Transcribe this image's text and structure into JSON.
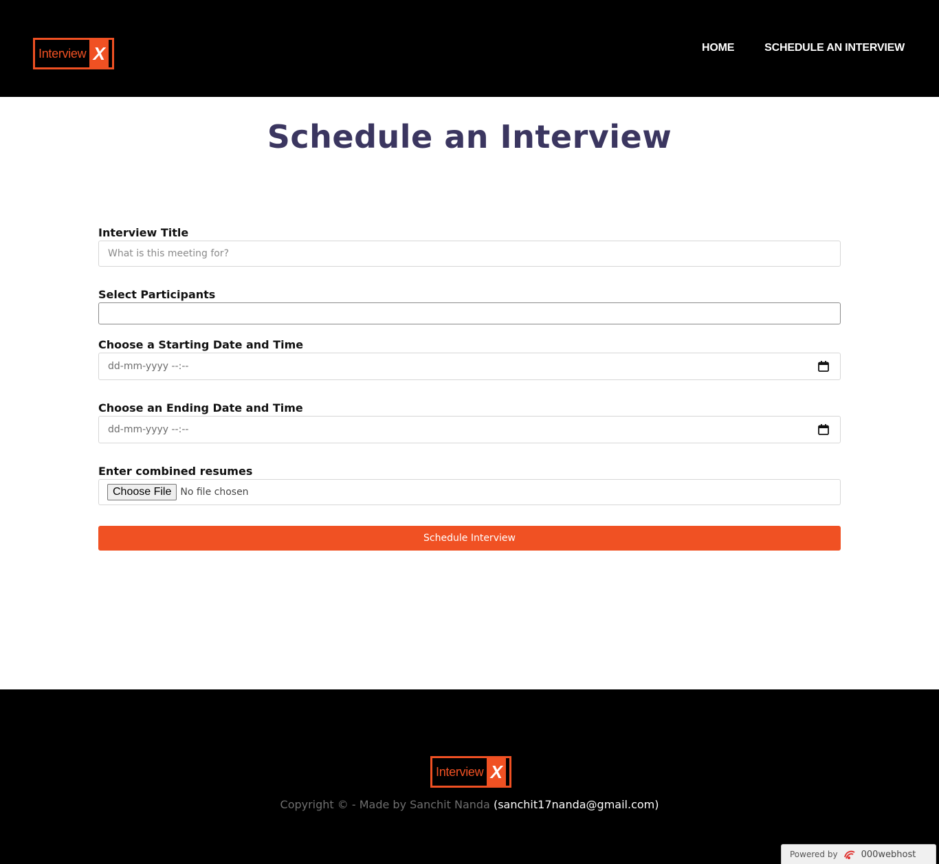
{
  "header": {
    "logo": {
      "text": "Interview",
      "mark": "X"
    },
    "nav": [
      {
        "label": "HOME"
      },
      {
        "label": "SCHEDULE AN INTERVIEW"
      }
    ]
  },
  "main": {
    "title": "Schedule an Interview",
    "form": {
      "interview_title": {
        "label": "Interview Title",
        "placeholder": "What is this meeting for?",
        "value": ""
      },
      "participants": {
        "label": "Select Participants",
        "value": ""
      },
      "start": {
        "label": "Choose a Starting Date and Time",
        "display": "dd-mm-yyyy --:--",
        "icon": "calendar-icon"
      },
      "end": {
        "label": "Choose an Ending Date and Time",
        "display": "dd-mm-yyyy --:--",
        "icon": "calendar-icon"
      },
      "resumes": {
        "label": "Enter combined resumes",
        "button": "Choose File",
        "status": "No file chosen"
      },
      "submit": {
        "label": "Schedule Interview"
      }
    }
  },
  "footer": {
    "logo": {
      "text": "Interview",
      "mark": "X"
    },
    "copyright": "Copyright © - Made by Sanchit Nanda",
    "email": "(sanchit17nanda@gmail.com)",
    "powered": {
      "label": "Powered by",
      "brand": "000webhost",
      "icon": "000webhost-logo-icon"
    }
  },
  "colors": {
    "accent": "#f05123",
    "header_bg": "#000000",
    "title": "#3b3660"
  }
}
